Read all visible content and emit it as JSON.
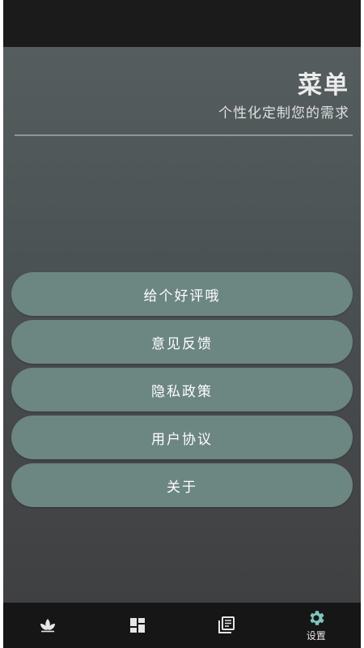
{
  "header": {
    "title": "菜单",
    "subtitle": "个性化定制您的需求"
  },
  "menu": {
    "items": [
      {
        "label": "给个好评哦"
      },
      {
        "label": "意见反馈"
      },
      {
        "label": "隐私政策"
      },
      {
        "label": "用户协议"
      },
      {
        "label": "关于"
      }
    ]
  },
  "bottom_nav": {
    "items": [
      {
        "icon": "lotus-icon",
        "label": ""
      },
      {
        "icon": "dashboard-grid-icon",
        "label": ""
      },
      {
        "icon": "library-books-icon",
        "label": ""
      },
      {
        "icon": "gear-icon",
        "label": "设置",
        "active": true
      }
    ]
  },
  "colors": {
    "button_fill": "#6c8681",
    "active_tab": "#7fc6bd",
    "nav_background": "#161616"
  }
}
